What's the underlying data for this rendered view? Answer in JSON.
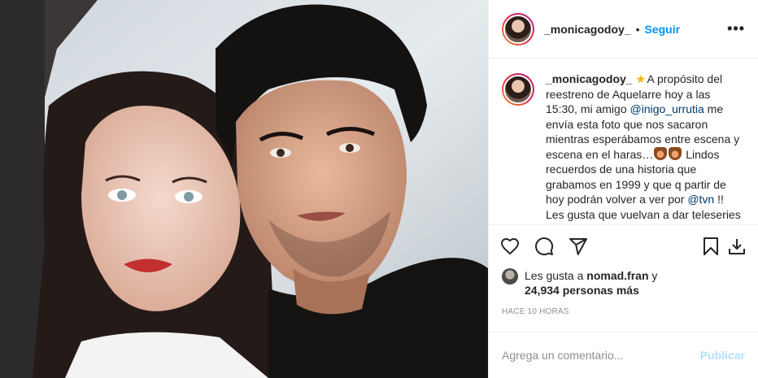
{
  "post": {
    "username": "_monicagodoy_",
    "separator": "•",
    "follow_label": "Seguir",
    "more_label": "•••"
  },
  "caption": {
    "username": "_monicagodoy_",
    "star": "★",
    "text_1": "A propósito del reestreno de Aquelarre hoy a las 15:30, mi amigo ",
    "mention_1": "@inigo_urrutia",
    "text_2": " me envía esta foto que nos sacaron mientras esperábamos entre escena y escena en el haras…",
    "text_3": " Lindos recuerdos de una historia que grabamos en 1999 y que q partir de hoy podrán volver a ver por ",
    "mention_2": "@tvn",
    "text_4": " !! Les gusta que vuelvan a dar teleseries de esos"
  },
  "likes": {
    "prefix": "Les gusta a ",
    "user": "nomad.fran",
    "conj": " y",
    "count": "24,934 personas más"
  },
  "time": "HACE 10 HORAS",
  "comment": {
    "placeholder": "Agrega un comentario...",
    "publish_label": "Publicar"
  },
  "icons": [
    "heart-icon",
    "comment-icon",
    "share-icon",
    "bookmark-icon",
    "download-icon"
  ]
}
